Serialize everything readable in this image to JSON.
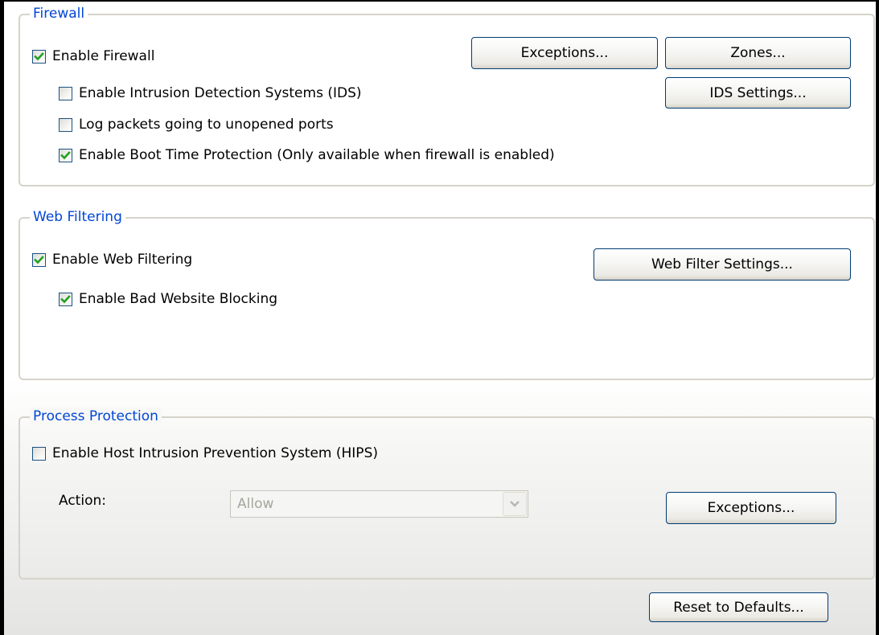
{
  "firewall": {
    "legend": "Firewall",
    "enable_firewall": {
      "label": "Enable Firewall",
      "checked": true
    },
    "enable_ids": {
      "label": "Enable Intrusion Detection Systems (IDS)",
      "checked": false
    },
    "log_packets": {
      "label": "Log packets going to unopened ports",
      "checked": false
    },
    "boot_time": {
      "label": "Enable Boot Time Protection (Only available when firewall is enabled)",
      "checked": true
    },
    "exceptions_button": "Exceptions...",
    "zones_button": "Zones...",
    "ids_settings_button": "IDS Settings..."
  },
  "web_filtering": {
    "legend": "Web Filtering",
    "enable_web_filtering": {
      "label": "Enable Web Filtering",
      "checked": true
    },
    "bad_website_blocking": {
      "label": "Enable Bad Website Blocking",
      "checked": true
    },
    "settings_button": "Web Filter Settings..."
  },
  "process_protection": {
    "legend": "Process Protection",
    "enable_hips": {
      "label": "Enable Host Intrusion Prevention System (HIPS)",
      "checked": false
    },
    "action_label": "Action:",
    "action_value": "Allow",
    "action_enabled": false,
    "exceptions_button": "Exceptions..."
  },
  "footer": {
    "reset_button": "Reset to Defaults..."
  },
  "colors": {
    "legend": "#0046d5",
    "group_border": "#d6d3ca",
    "checkbox_border": "#1c5180",
    "checkmark": "#21a121",
    "button_border": "#003c74"
  },
  "icons": {
    "checkmark": "check-icon",
    "dropdown": "chevron-down-icon"
  }
}
